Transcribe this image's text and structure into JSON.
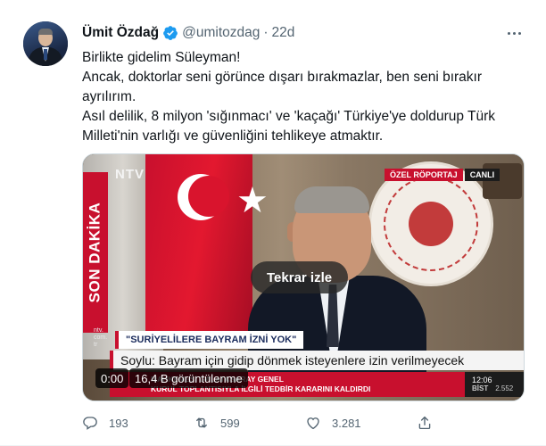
{
  "tweet": {
    "author_name": "Ümit Özdağ",
    "author_handle": "@umitozdag",
    "separator": "·",
    "time": "22d",
    "paragraphs": [
      "Birlikte gidelim Süleyman!",
      "Ancak, doktorlar seni görünce dışarı bırakmazlar, ben seni bırakır ayrılırım.",
      "Asıl delilik, 8 milyon 'sığınmacı' ve 'kaçağı' Türkiye'ye doldurup Türk Milleti'nin varlığı ve güvenliğini tehlikeye atmaktır."
    ]
  },
  "video": {
    "channel_logo": "NTV",
    "side_banner": "SON DAKİKA",
    "tag_special": "ÖZEL RÖPORTAJ",
    "tag_live": "CANLI",
    "site_small": "ntv.\ncom.\ntr",
    "replay_label": "Tekrar izle",
    "headline_tag": "\"SURİYELİLERE BAYRAM İZNİ YOK\"",
    "headline": "Soylu: Bayram için gidip dönmek isteyenlere izin verilmeyecek",
    "ticker_line1": "MAHKEMESİ GALATASARAY GENEL",
    "ticker_line2": "KURUL TOPLANTISIYLA İLGİLİ TEDBİR KARARINI KALDIRDI",
    "clock": "12:06",
    "bist_label": "BİST",
    "bist_value": "2.552",
    "playback_time": "0:00",
    "views": "16,4 B görüntülenme"
  },
  "actions": {
    "replies": "193",
    "retweets": "599",
    "likes": "3.281"
  },
  "colors": {
    "verified": "#1d9bf0",
    "muted": "#536471",
    "ntv_red": "#c8102e"
  }
}
